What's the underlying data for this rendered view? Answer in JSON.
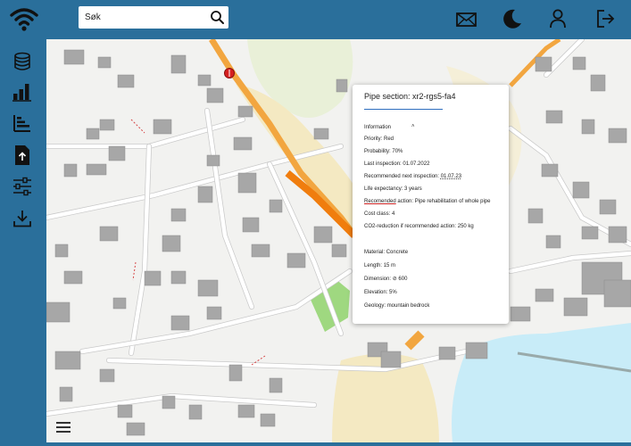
{
  "header": {
    "logo_icon": "wifi-signal-icon",
    "search": {
      "value": "Søk",
      "icon": "search-icon"
    },
    "actions": [
      "mail-icon",
      "moon-icon",
      "user-icon",
      "logout-icon"
    ]
  },
  "sidebar": {
    "items": [
      "database-icon",
      "bar-chart-icon",
      "list-sort-icon",
      "file-upload-icon",
      "sliders-icon",
      "download-icon"
    ]
  },
  "map": {
    "panel": {
      "title": "Pipe section: xr2-rgs5-fa4",
      "section_header": "Information",
      "priority_label": "Priority:",
      "priority_value": "Red",
      "probability_label": "Probability:",
      "probability_value": "70%",
      "last_inspection_label": "Last inspection:",
      "last_inspection_value": "01.07.2022",
      "next_inspection_label": "Recommended next inspection:",
      "next_inspection_value": "01.07.23",
      "life_expectancy_label": "Life expectancy:",
      "life_expectancy_value": "3 years",
      "action_label_word": "Recomended",
      "action_label_rest": " action:",
      "action_value": "Pipe rehabilitation of whole pipe",
      "cost_label": "Cost class:",
      "cost_value": "4",
      "co2_label": "CO2-reduction if recommended action:",
      "co2_value": "250 kg",
      "material_label": "Material:",
      "material_value": "Concrete",
      "length_label": "Length:",
      "length_value": "15 m",
      "dimension_label": "Dimension:",
      "dimension_symbol": "⊘",
      "dimension_value": "600",
      "elevation_label": "Elevation:",
      "elevation_value": "5%",
      "geology_label": "Geology:",
      "geology_value": "mountain bedrock"
    },
    "colors": {
      "pipe_highlight": "#f07d0e",
      "pipe_secondary": "#f2a640",
      "marker": "#d62020",
      "water": "#c8ecf8"
    }
  }
}
